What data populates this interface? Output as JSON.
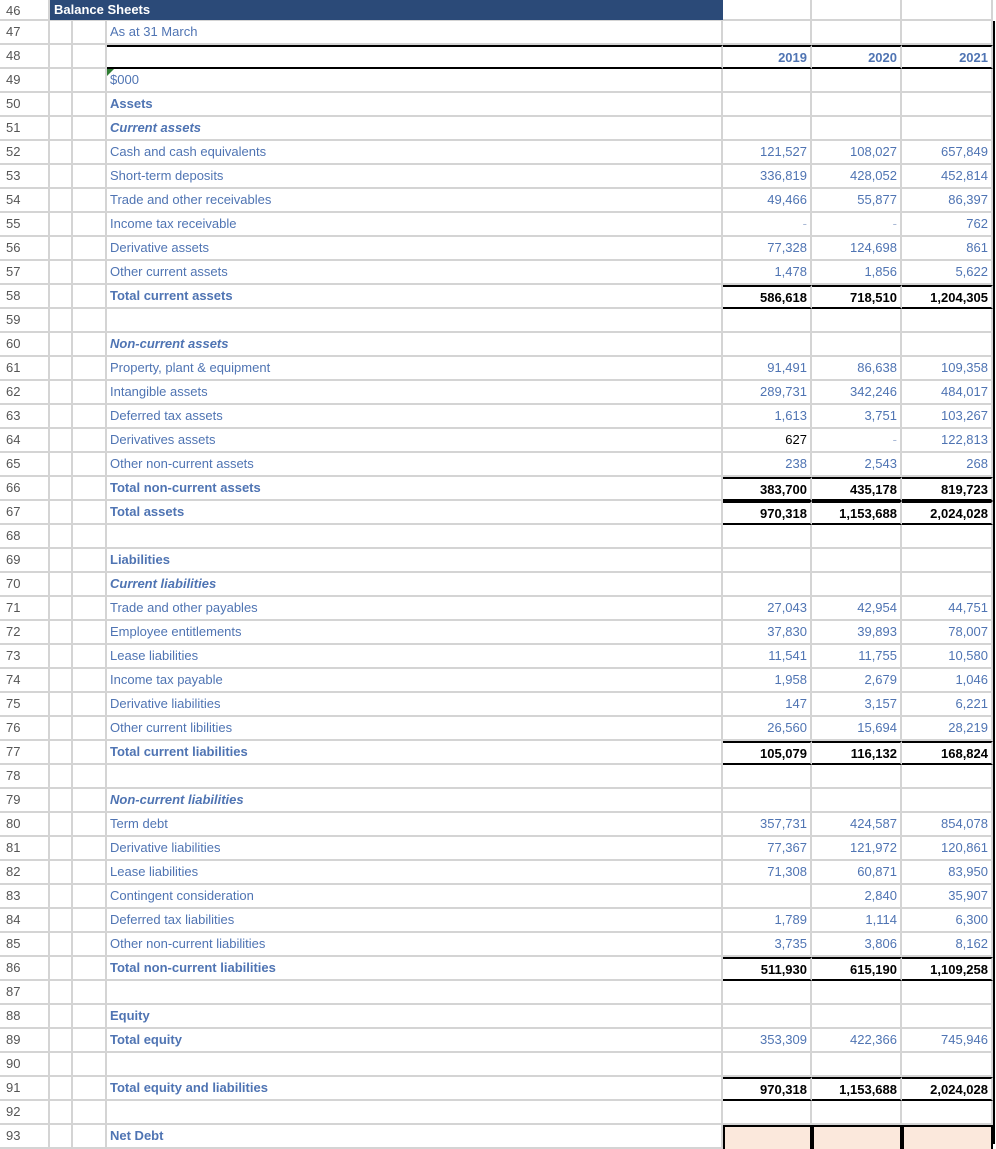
{
  "sheet": {
    "title": "Balance Sheets",
    "subtitle": "As at 31 March",
    "unit": "$000",
    "years": [
      "2019",
      "2020",
      "2021"
    ],
    "rows": [
      {
        "n": "46"
      },
      {
        "n": "47"
      },
      {
        "n": "48"
      },
      {
        "n": "49"
      },
      {
        "n": "50",
        "label": "Assets",
        "style": "bold"
      },
      {
        "n": "51",
        "label": "Current assets",
        "style": "italic"
      },
      {
        "n": "52",
        "label": "Cash and cash equivalents",
        "v": [
          "121,527",
          "108,027",
          "657,849"
        ]
      },
      {
        "n": "53",
        "label": "Short-term deposits",
        "v": [
          "336,819",
          "428,052",
          "452,814"
        ]
      },
      {
        "n": "54",
        "label": "Trade and other receivables",
        "v": [
          "49,466",
          "55,877",
          "86,397"
        ]
      },
      {
        "n": "55",
        "label": "Income tax receivable",
        "v": [
          "-",
          "-",
          "762"
        ]
      },
      {
        "n": "56",
        "label": "Derivative assets",
        "v": [
          "77,328",
          "124,698",
          "861"
        ]
      },
      {
        "n": "57",
        "label": "Other current assets",
        "v": [
          "1,478",
          "1,856",
          "5,622"
        ]
      },
      {
        "n": "58",
        "label": "Total current assets",
        "style": "bold",
        "total": true,
        "v": [
          "586,618",
          "718,510",
          "1,204,305"
        ]
      },
      {
        "n": "59"
      },
      {
        "n": "60",
        "label": "Non-current assets",
        "style": "italic"
      },
      {
        "n": "61",
        "label": "Property, plant & equipment",
        "v": [
          "91,491",
          "86,638",
          "109,358"
        ]
      },
      {
        "n": "62",
        "label": "Intangible assets",
        "v": [
          "289,731",
          "342,246",
          "484,017"
        ]
      },
      {
        "n": "63",
        "label": "Deferred tax assets",
        "v": [
          "1,613",
          "3,751",
          "103,267"
        ]
      },
      {
        "n": "64",
        "label": "Derivatives assets",
        "v": [
          "627",
          "-",
          "122,813"
        ],
        "black": [
          0
        ]
      },
      {
        "n": "65",
        "label": "Other non-current assets",
        "v": [
          "238",
          "2,543",
          "268"
        ]
      },
      {
        "n": "66",
        "label": "Total non-current assets",
        "style": "bold",
        "total": true,
        "v": [
          "383,700",
          "435,178",
          "819,723"
        ]
      },
      {
        "n": "67",
        "label": "Total assets",
        "style": "bold",
        "total": true,
        "v": [
          "970,318",
          "1,153,688",
          "2,024,028"
        ]
      },
      {
        "n": "68"
      },
      {
        "n": "69",
        "label": "Liabilities",
        "style": "bold"
      },
      {
        "n": "70",
        "label": "Current liabilities",
        "style": "italic"
      },
      {
        "n": "71",
        "label": "Trade and other payables",
        "v": [
          "27,043",
          "42,954",
          "44,751"
        ]
      },
      {
        "n": "72",
        "label": "Employee entitlements",
        "v": [
          "37,830",
          "39,893",
          "78,007"
        ]
      },
      {
        "n": "73",
        "label": "Lease liabilities",
        "v": [
          "11,541",
          "11,755",
          "10,580"
        ]
      },
      {
        "n": "74",
        "label": "Income tax payable",
        "v": [
          "1,958",
          "2,679",
          "1,046"
        ]
      },
      {
        "n": "75",
        "label": "Derivative liabilities",
        "v": [
          "147",
          "3,157",
          "6,221"
        ]
      },
      {
        "n": "76",
        "label": "Other current libilities",
        "v": [
          "26,560",
          "15,694",
          "28,219"
        ]
      },
      {
        "n": "77",
        "label": "Total current liabilities",
        "style": "bold",
        "total": true,
        "v": [
          "105,079",
          "116,132",
          "168,824"
        ]
      },
      {
        "n": "78"
      },
      {
        "n": "79",
        "label": "Non-current liabilities",
        "style": "italic"
      },
      {
        "n": "80",
        "label": "Term debt",
        "v": [
          "357,731",
          "424,587",
          "854,078"
        ]
      },
      {
        "n": "81",
        "label": "Derivative liabilities",
        "v": [
          "77,367",
          "121,972",
          "120,861"
        ]
      },
      {
        "n": "82",
        "label": "Lease liabilities",
        "v": [
          "71,308",
          "60,871",
          "83,950"
        ]
      },
      {
        "n": "83",
        "label": "Contingent consideration",
        "v": [
          "",
          "2,840",
          "35,907"
        ]
      },
      {
        "n": "84",
        "label": "Deferred tax liabilities",
        "v": [
          "1,789",
          "1,114",
          "6,300"
        ]
      },
      {
        "n": "85",
        "label": "Other non-current liabilities",
        "v": [
          "3,735",
          "3,806",
          "8,162"
        ]
      },
      {
        "n": "86",
        "label": "Total non-current liabilities",
        "style": "bold",
        "total": true,
        "v": [
          "511,930",
          "615,190",
          "1,109,258"
        ]
      },
      {
        "n": "87"
      },
      {
        "n": "88",
        "label": "Equity",
        "style": "bold"
      },
      {
        "n": "89",
        "label": "Total equity",
        "style": "bold",
        "v": [
          "353,309",
          "422,366",
          "745,946"
        ]
      },
      {
        "n": "90"
      },
      {
        "n": "91",
        "label": "Total equity and liabilities",
        "style": "bold",
        "total": true,
        "v": [
          "970,318",
          "1,153,688",
          "2,024,028"
        ]
      },
      {
        "n": "92"
      },
      {
        "n": "93",
        "label": "Net Debt",
        "style": "bold",
        "netdebt": true
      }
    ]
  },
  "colors": {
    "header_bar": "#2b4a78",
    "label_blue": "#4f74b3",
    "net_debt_fill": "#fbe8dc"
  }
}
